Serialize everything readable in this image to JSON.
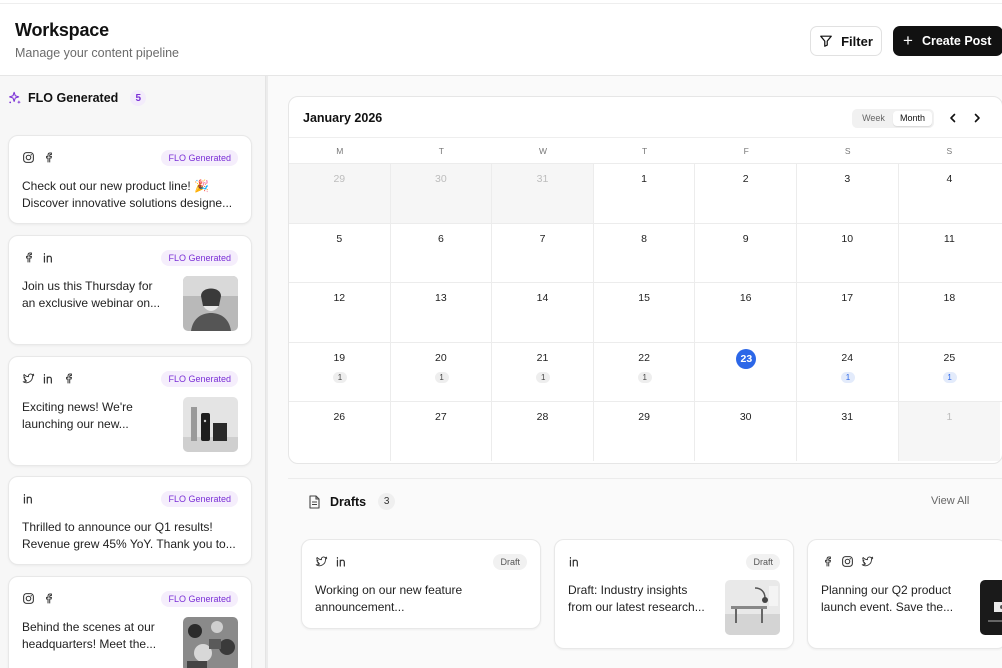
{
  "header": {
    "title": "Workspace",
    "subtitle": "Manage your content pipeline",
    "filter_label": "Filter",
    "create_label": "Create Post"
  },
  "sidebar": {
    "title": "FLO Generated",
    "count": "5",
    "cards": [
      {
        "icons": [
          "instagram-icon",
          "facebook-icon"
        ],
        "tag": "FLO Generated",
        "line1": "Check out our new product line! 🎉",
        "line2": "Discover innovative solutions designe..."
      },
      {
        "icons": [
          "facebook-icon",
          "linkedin-icon"
        ],
        "tag": "FLO Generated",
        "line1": "Join us this Thursday for",
        "line2": "an exclusive webinar on..."
      },
      {
        "icons": [
          "twitter-icon",
          "linkedin-icon",
          "facebook-icon"
        ],
        "tag": "FLO Generated",
        "line1": "Exciting news! We're",
        "line2": "launching our new..."
      },
      {
        "icons": [
          "linkedin-icon"
        ],
        "tag": "FLO Generated",
        "line1": "Thrilled to announce our Q1 results!",
        "line2": "Revenue grew 45% YoY. Thank you to..."
      },
      {
        "icons": [
          "instagram-icon",
          "facebook-icon"
        ],
        "tag": "FLO Generated",
        "line1": "Behind the scenes at our",
        "line2": "headquarters! Meet the..."
      }
    ]
  },
  "calendar": {
    "title": "January 2026",
    "view_week": "Week",
    "view_month": "Month",
    "day_headers": [
      "M",
      "T",
      "W",
      "T",
      "F",
      "S",
      "S"
    ],
    "weeks": [
      [
        {
          "n": "29",
          "muted": true
        },
        {
          "n": "30",
          "muted": true
        },
        {
          "n": "31",
          "muted": true
        },
        {
          "n": "1"
        },
        {
          "n": "2"
        },
        {
          "n": "3"
        },
        {
          "n": "4"
        }
      ],
      [
        {
          "n": "5"
        },
        {
          "n": "6"
        },
        {
          "n": "7"
        },
        {
          "n": "8"
        },
        {
          "n": "9"
        },
        {
          "n": "10"
        },
        {
          "n": "11"
        }
      ],
      [
        {
          "n": "12"
        },
        {
          "n": "13"
        },
        {
          "n": "14"
        },
        {
          "n": "15"
        },
        {
          "n": "16"
        },
        {
          "n": "17"
        },
        {
          "n": "18"
        }
      ],
      [
        {
          "n": "19",
          "badge": "1"
        },
        {
          "n": "20",
          "badge": "1"
        },
        {
          "n": "21",
          "badge": "1"
        },
        {
          "n": "22",
          "badge": "1"
        },
        {
          "n": "23",
          "today": true
        },
        {
          "n": "24",
          "badge": "1",
          "blue": true
        },
        {
          "n": "25",
          "badge": "1",
          "blue": true
        }
      ],
      [
        {
          "n": "26"
        },
        {
          "n": "27"
        },
        {
          "n": "28"
        },
        {
          "n": "29"
        },
        {
          "n": "30"
        },
        {
          "n": "31"
        },
        {
          "n": "1",
          "muted": true
        }
      ]
    ]
  },
  "drafts": {
    "title": "Drafts",
    "count": "3",
    "view_all": "View All",
    "cards": [
      {
        "icons": [
          "twitter-icon",
          "linkedin-icon"
        ],
        "tag": "Draft",
        "line1": "Working on our new feature",
        "line2": "announcement..."
      },
      {
        "icons": [
          "linkedin-icon"
        ],
        "tag": "Draft",
        "line1": "Draft: Industry insights",
        "line2": "from our latest research..."
      },
      {
        "icons": [
          "facebook-icon",
          "instagram-icon",
          "twitter-icon"
        ],
        "tag": "",
        "line1": "Planning our Q2 product",
        "line2": "launch event. Save the..."
      }
    ]
  },
  "colors": {
    "accent_purple": "#7a2fd6",
    "today_blue": "#2c67e8",
    "primary_button": "#111111"
  }
}
